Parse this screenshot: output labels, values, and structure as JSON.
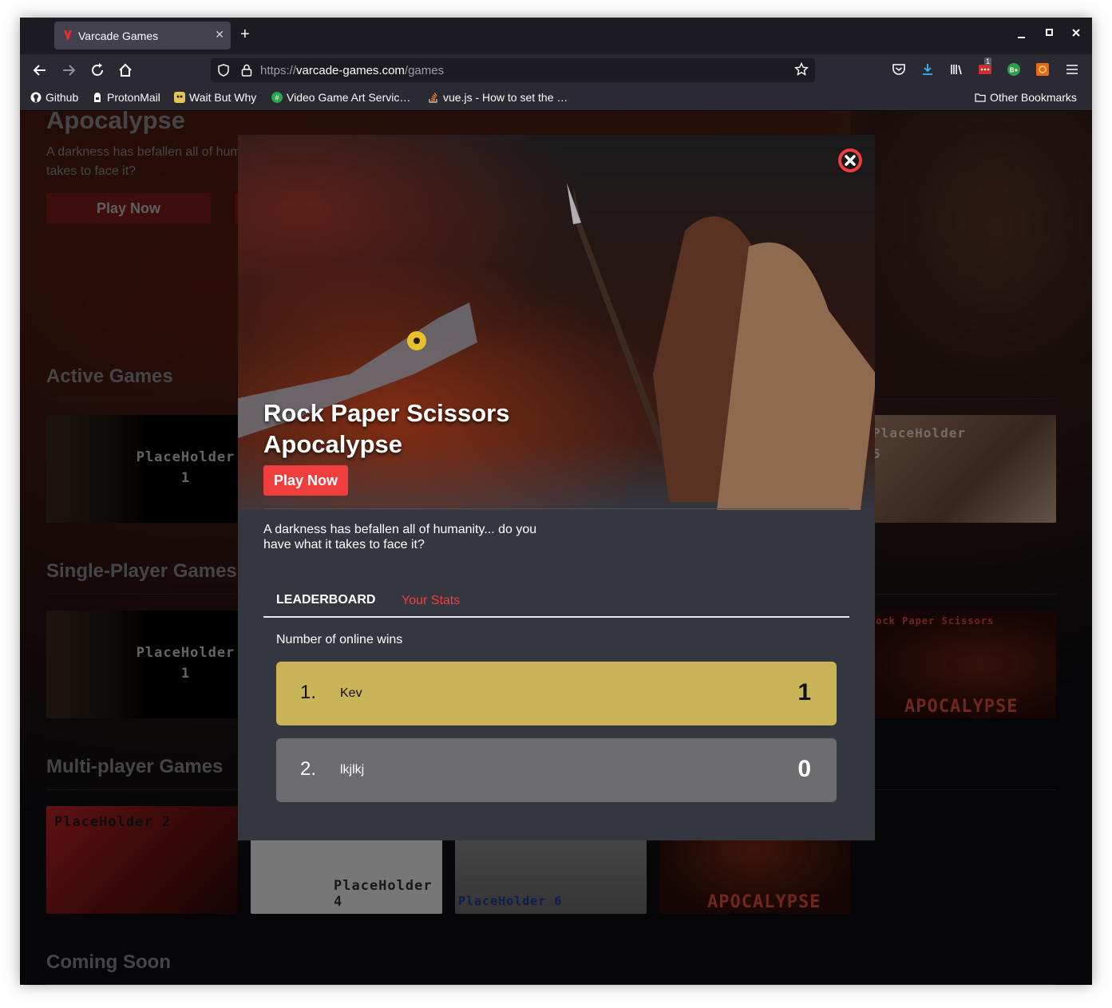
{
  "browser": {
    "tab_title": "Varcade Games",
    "tab_close": "✕",
    "new_tab": "+",
    "url_protocol": "https://",
    "url_host": "varcade-games.com",
    "url_path": "/games",
    "bookmarks": [
      {
        "label": "Github",
        "icon": "github-icon",
        "color": "#fbfbfe"
      },
      {
        "label": "ProtonMail",
        "icon": "protonmail-icon",
        "color": "#fbfbfe"
      },
      {
        "label": "Wait But Why",
        "icon": "waitbutwhy-icon",
        "color": "#e8c35a"
      },
      {
        "label": "Video Game Art Servic…",
        "icon": "vgart-icon",
        "color": "#2aa84a"
      },
      {
        "label": "vue.js - How to set the …",
        "icon": "stackoverflow-icon",
        "color": "#f48024"
      }
    ],
    "other_bookmarks": "Other Bookmarks",
    "extension_badge": "1"
  },
  "background": {
    "hero_title": "Apocalypse",
    "hero_desc": "A darkness has befallen all of hum takes to face it?",
    "hero_play": "Play Now",
    "sections": [
      {
        "title": "Active Games"
      },
      {
        "title": "Single-Player Games"
      },
      {
        "title": "Multi-player Games"
      },
      {
        "title": "Coming Soon"
      }
    ],
    "cards": {
      "active_1": "PlaceHolder 1",
      "active_5": "PlaceHolder 5",
      "single_1": "PlaceHolder 1",
      "single_rps_top": "Rock Paper Scissors",
      "single_rps_bottom": "APOCALYPSE",
      "multi_2": "PlaceHolder 2",
      "multi_4": "PlaceHolder 4",
      "multi_6": "PlaceHolder 6",
      "multi_rps": "APOCALYPSE"
    }
  },
  "modal": {
    "title_line1": "Rock Paper Scissors",
    "title_line2": "Apocalypse",
    "play_label": "Play Now",
    "description": "A darkness has befallen all of humanity... do you have what it takes to face it?",
    "tabs": {
      "leaderboard": "LEADERBOARD",
      "stats": "Your Stats"
    },
    "leaderboard_caption": "Number of online wins",
    "leaderboard": [
      {
        "rank": "1.",
        "name": "Kev",
        "score": "1",
        "color": "#c9b458"
      },
      {
        "rank": "2.",
        "name": "lkjlkj",
        "score": "0",
        "color": "#6c6c70"
      }
    ],
    "accent": "#f03e3e"
  }
}
